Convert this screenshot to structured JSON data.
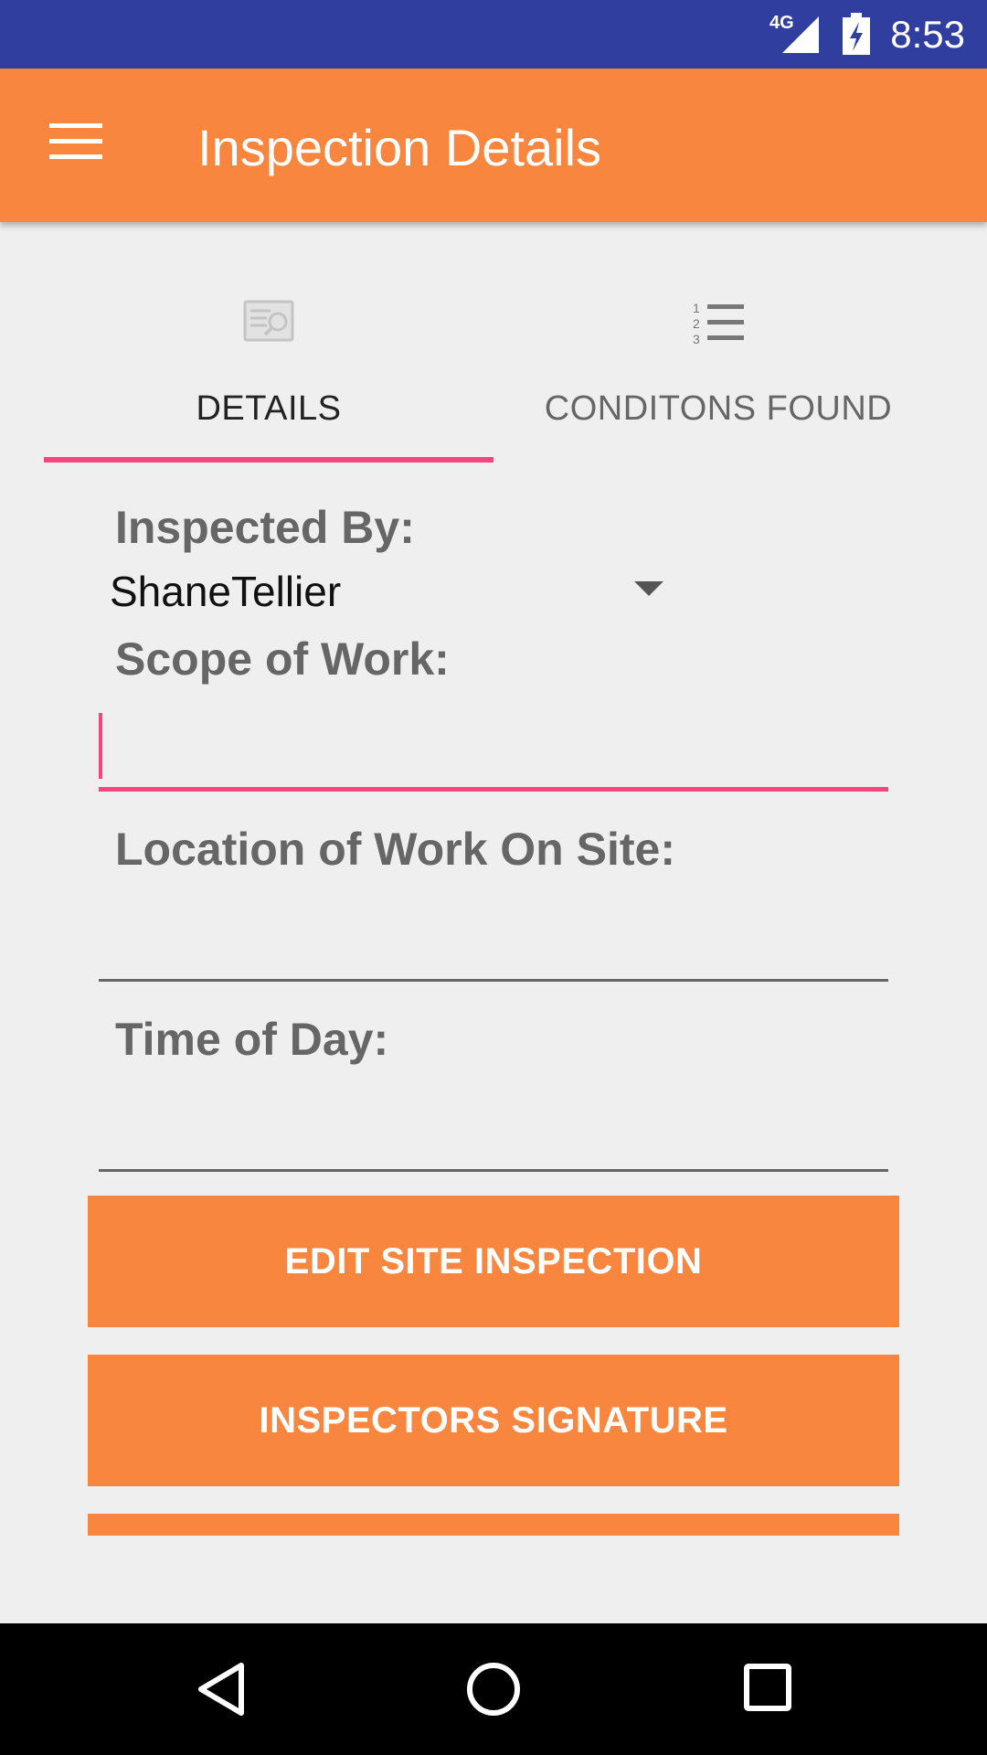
{
  "status_bar": {
    "network": "4G",
    "time": "8:53",
    "icons": [
      "signal-icon",
      "battery-charging-icon"
    ]
  },
  "app_bar": {
    "title": "Inspection Details",
    "menu_icon": "menu-icon"
  },
  "tabs": [
    {
      "label": "DETAILS",
      "icon": "inspection-report-icon",
      "selected": true
    },
    {
      "label": "CONDITONS FOUND",
      "icon": "numbered-list-icon",
      "selected": false
    }
  ],
  "form": {
    "inspected_by": {
      "label": "Inspected By:",
      "value": "ShaneTellier"
    },
    "scope_of_work": {
      "label": "Scope of Work:",
      "value": ""
    },
    "location": {
      "label": "Location of Work On Site:",
      "value": ""
    },
    "time_of_day": {
      "label": "Time of Day:",
      "value": ""
    }
  },
  "buttons": {
    "edit_site_inspection": "EDIT SITE INSPECTION",
    "inspectors_signature": "INSPECTORS SIGNATURE"
  },
  "colors": {
    "status_bar": "#303f9f",
    "accent_orange": "#f9863f",
    "accent_pink": "#f4457f",
    "background": "#efefef"
  },
  "nav_bar": {
    "icons": [
      "back-icon",
      "home-icon",
      "recents-icon"
    ]
  }
}
